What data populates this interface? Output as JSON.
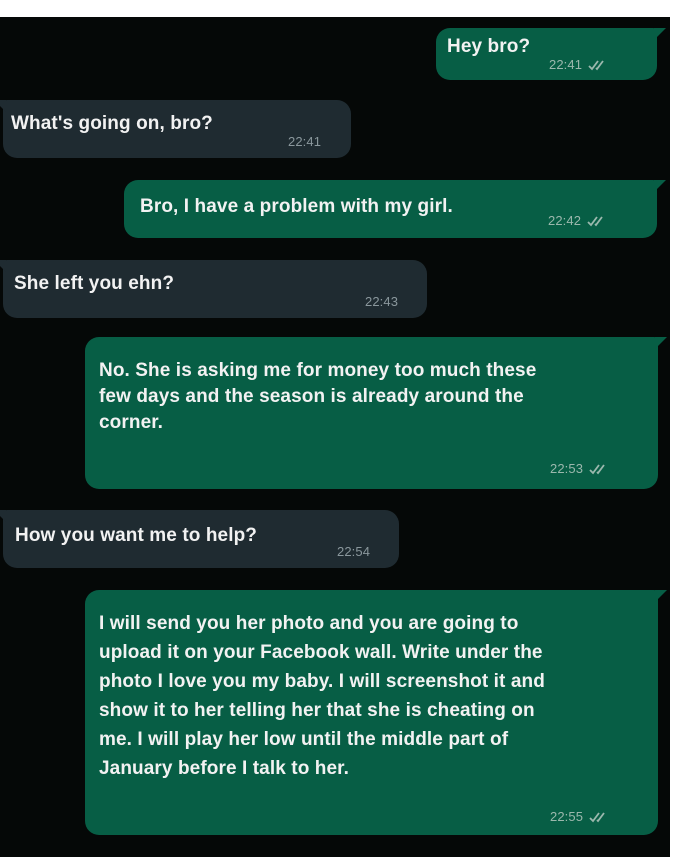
{
  "chat": {
    "messages": [
      {
        "direction": "outgoing",
        "text": "Hey bro?",
        "time": "22:41",
        "status_icon": "double-check-icon"
      },
      {
        "direction": "incoming",
        "text": "What's going on, bro?",
        "time": "22:41"
      },
      {
        "direction": "outgoing",
        "text": "Bro, I have a problem with my girl.",
        "time": "22:42",
        "status_icon": "double-check-icon"
      },
      {
        "direction": "incoming",
        "text": "She left you ehn?",
        "time": "22:43"
      },
      {
        "direction": "outgoing",
        "text": "No. She is asking me for money too much these\nfew days and the season is already around the\ncorner.",
        "time": "22:53",
        "status_icon": "double-check-icon"
      },
      {
        "direction": "incoming",
        "text": "How you want me to help?",
        "time": "22:54"
      },
      {
        "direction": "outgoing",
        "text": "I will send you her photo and you are going to\nupload it on your Facebook wall. Write under the\nphoto I love you my baby. I will screenshot it and\nshow it to her telling her that she is cheating on\nme. I will play her low until the middle part of\nJanuary before I talk to her.",
        "time": "22:55",
        "status_icon": "double-check-icon"
      }
    ]
  },
  "colors": {
    "outgoing_bubble": "#075e45",
    "incoming_bubble": "#1f2b31",
    "background": "#050807",
    "tick": "#9bb8ad"
  }
}
